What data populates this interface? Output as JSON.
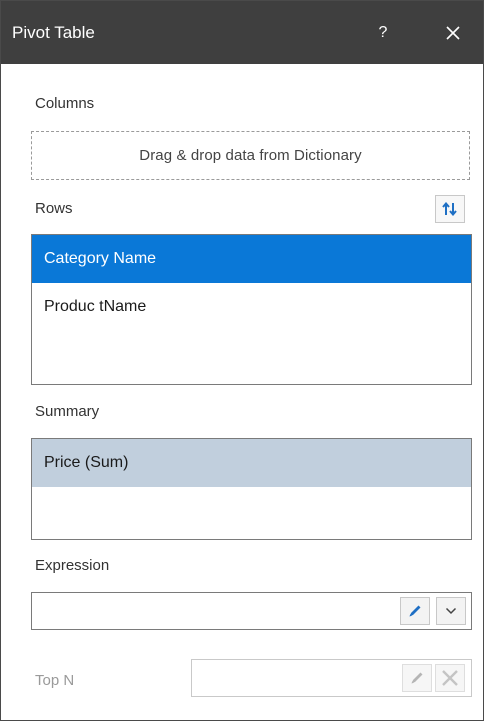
{
  "window": {
    "title": "Pivot Table",
    "help_label": "?"
  },
  "columns": {
    "label": "Columns",
    "dropzone_text": "Drag & drop data from Dictionary"
  },
  "rows": {
    "label": "Rows",
    "items": [
      {
        "label": "Category Name",
        "state": "selected"
      },
      {
        "label": "Produc tName",
        "state": "normal"
      }
    ]
  },
  "summary": {
    "label": "Summary",
    "items": [
      {
        "label": "Price (Sum)",
        "state": "selected-inactive"
      }
    ]
  },
  "expression": {
    "label": "Expression",
    "value": ""
  },
  "top_n": {
    "label": "Top N",
    "value": "",
    "enabled": false
  },
  "colors": {
    "titlebar": "#3f3f3f",
    "selection": "#0a78d7",
    "inactive_selection": "#c1cfdd",
    "edit_icon": "#1e6fc4"
  }
}
